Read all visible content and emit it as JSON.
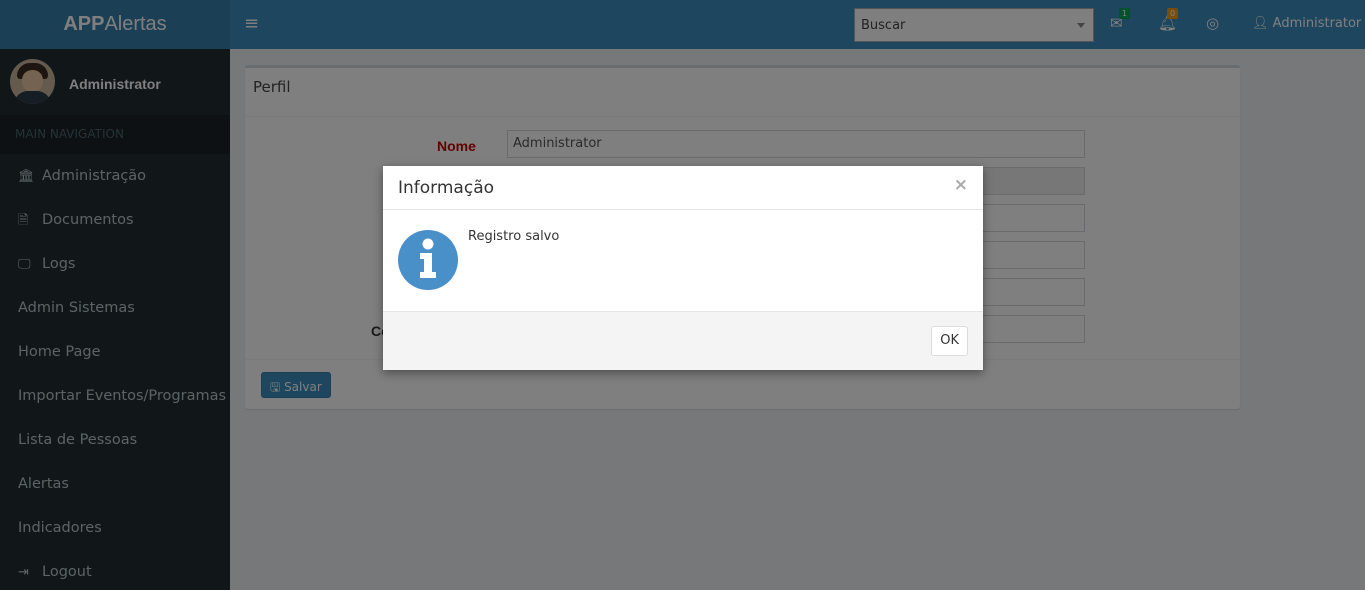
{
  "header": {
    "logo_bold": "APP",
    "logo_rest": "Alertas",
    "search_placeholder": "Buscar",
    "mail_badge": "1",
    "bell_badge": "0",
    "user_name": "Administrator",
    "colors": {
      "header": "#3c8dbc",
      "logo_bg": "#367fa9",
      "mail_badge": "#00a65a",
      "bell_badge": "#f39c12"
    }
  },
  "sidebar": {
    "user_name": "Administrator",
    "section_label": "MAIN NAVIGATION",
    "items": [
      {
        "label": "Administração",
        "icon": "bank-icon",
        "glyph": "🏛"
      },
      {
        "label": "Documentos",
        "icon": "file-icon",
        "glyph": "🗎"
      },
      {
        "label": "Logs",
        "icon": "desktop-icon",
        "glyph": "🖵"
      },
      {
        "label": "Admin Sistemas",
        "icon": "",
        "glyph": ""
      },
      {
        "label": "Home Page",
        "icon": "",
        "glyph": ""
      },
      {
        "label": "Importar Eventos/Programas",
        "icon": "",
        "glyph": ""
      },
      {
        "label": "Lista de Pessoas",
        "icon": "",
        "glyph": ""
      },
      {
        "label": "Alertas",
        "icon": "",
        "glyph": ""
      },
      {
        "label": "Indicadores",
        "icon": "",
        "glyph": ""
      },
      {
        "label": "Logout",
        "icon": "sign-out-icon",
        "glyph": "⇥"
      }
    ]
  },
  "profile": {
    "title": "Perfil",
    "name_label": "Nome",
    "name_value": "Administrator",
    "partial_label": "Co",
    "save_label": "Salvar"
  },
  "modal": {
    "title": "Informação",
    "close": "×",
    "message": "Registro salvo",
    "ok_label": "OK"
  }
}
